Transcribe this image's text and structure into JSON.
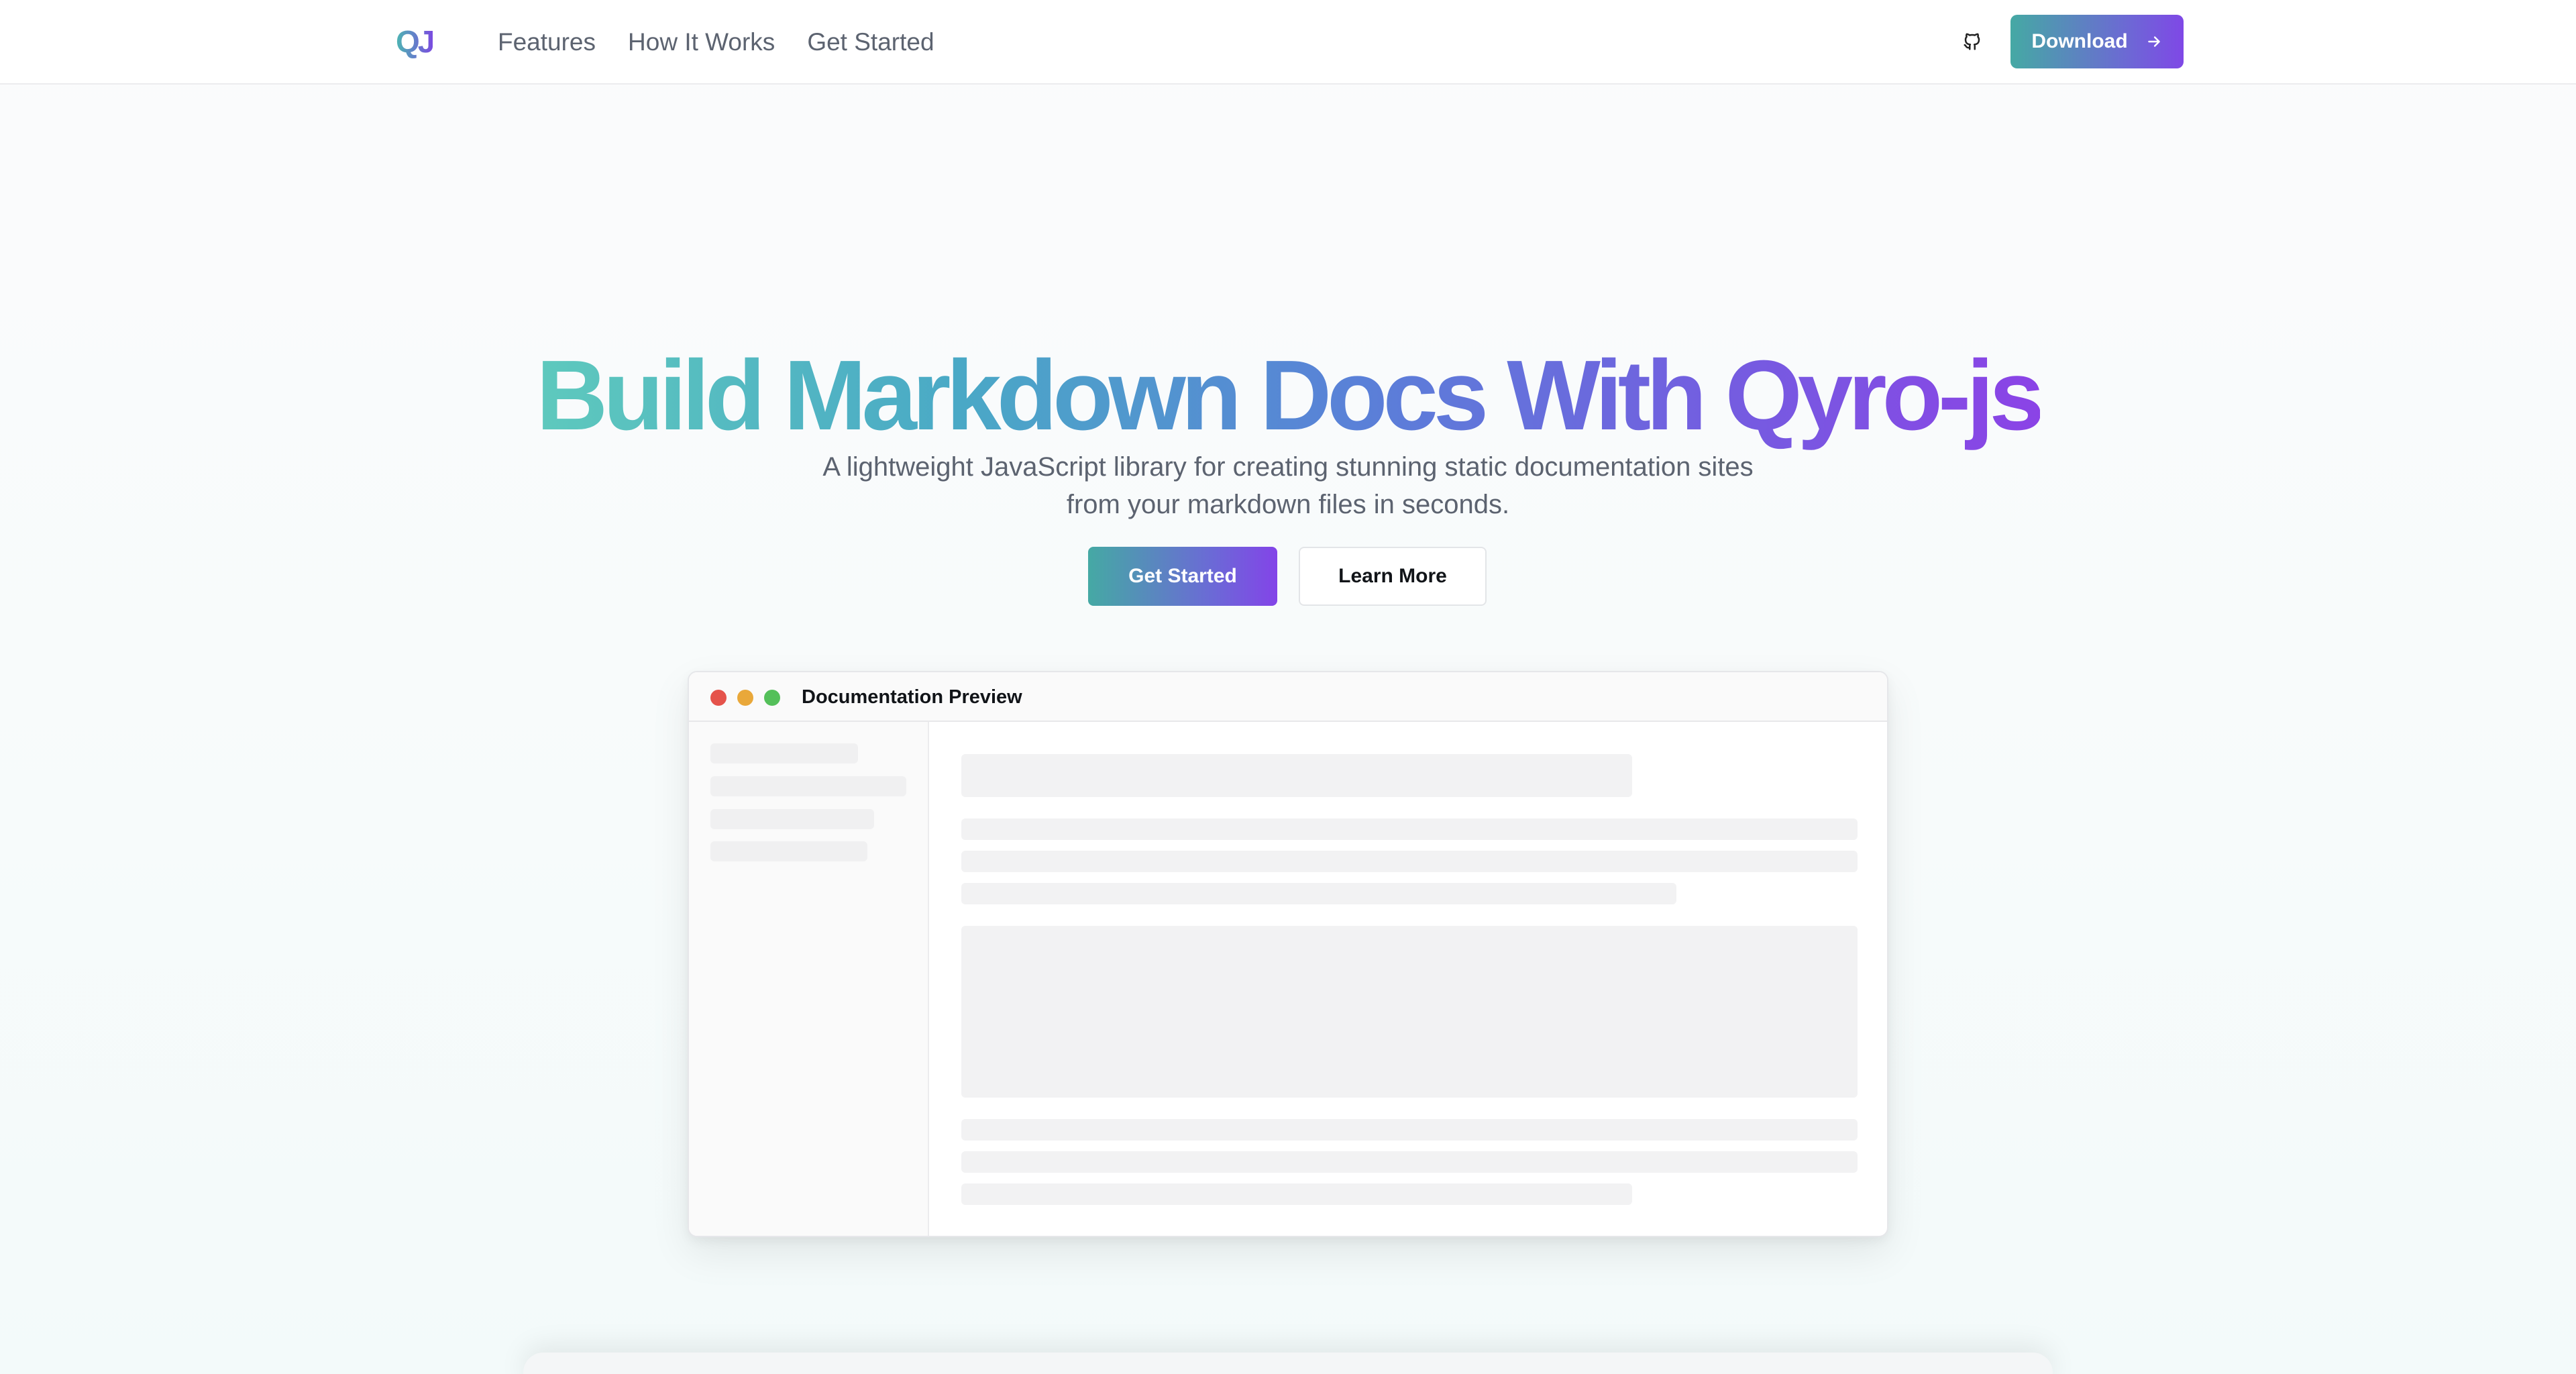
{
  "nav": {
    "logo_text": "QJ",
    "links": [
      "Features",
      "How It Works",
      "Get Started"
    ],
    "github_icon": "github-icon",
    "download_label": "Download",
    "download_icon": "arrow-right-icon"
  },
  "hero": {
    "title": "Build Markdown Docs With Qyro-js",
    "subtitle": "A lightweight JavaScript library for creating stunning static documentation sites from your markdown files in seconds.",
    "primary_label": "Get Started",
    "secondary_label": "Learn More"
  },
  "preview": {
    "title": "Documentation Preview",
    "window_controls": [
      "close",
      "minimize",
      "maximize"
    ]
  },
  "colors": {
    "gradient_start": "#5ec9bd",
    "gradient_mid": "#5a80d8",
    "gradient_end": "#8b43e6",
    "button_gradient_start": "#45a9a4",
    "button_gradient_end": "#8344e8",
    "window_close": "#e5534b",
    "window_minimize": "#e9a83a",
    "window_maximize": "#54c05a"
  }
}
